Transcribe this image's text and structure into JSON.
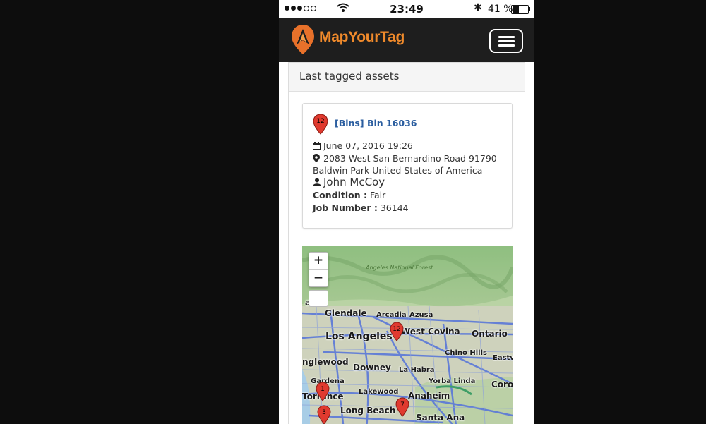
{
  "status_bar": {
    "signal_dots": [
      true,
      true,
      true,
      false,
      false
    ],
    "time": "23:49",
    "battery_percent": "41 %",
    "battery_level": 0.41
  },
  "navbar": {
    "brand": "MapYourTag",
    "brand_color": "#f08a2b",
    "menu_icon": "hamburger-icon"
  },
  "panel": {
    "heading": "Last tagged assets"
  },
  "asset": {
    "pin_number": "12",
    "category": "[Bins]",
    "name": "Bin 16036",
    "date": "June 07, 2016 19:26",
    "address_line1": "2083 West San Bernardino Road 91790",
    "address_line2": "Baldwin Park United States of America",
    "user": "John McCoy",
    "condition_label": "Condition :",
    "condition_value": "Fair",
    "job_label": "Job Number :",
    "job_value": "36144"
  },
  "map": {
    "zoom_in": "+",
    "zoom_out": "−",
    "labels": {
      "forest": "Angeles National Forest",
      "burbank": "ank",
      "glendale": "Glendale",
      "arcadia": "Arcadia",
      "azusa": "Azusa",
      "los_angeles": "Los Angeles",
      "west_covina": "West Covina",
      "ontario": "Ontario",
      "chino_hills": "Chino Hills",
      "eastvale": "Eastv",
      "inglewood": "nglewood",
      "downey": "Downey",
      "la_habra": "La Habra",
      "gardena": "Gardena",
      "yorba_linda": "Yorba Linda",
      "corona": "Coro",
      "lakewood": "Lakewood",
      "torrance": "Torrance",
      "anaheim": "Anaheim",
      "long_beach": "Long Beach",
      "santa_ana": "Santa Ana"
    },
    "markers": [
      "12",
      "1",
      "3",
      "7"
    ]
  }
}
